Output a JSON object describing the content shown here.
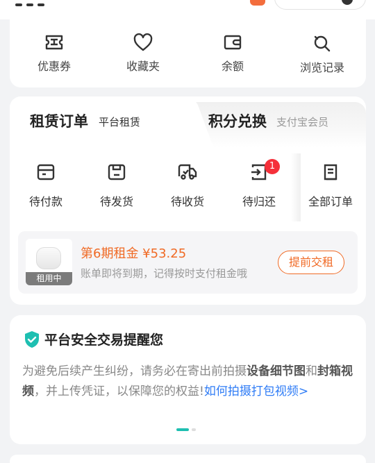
{
  "quick_links": [
    {
      "label": "优惠券",
      "icon": "coupon-icon"
    },
    {
      "label": "收藏夹",
      "icon": "heart-icon"
    },
    {
      "label": "余额",
      "icon": "wallet-icon"
    },
    {
      "label": "浏览记录",
      "icon": "history-icon"
    }
  ],
  "orders": {
    "tabs": [
      {
        "title": "租赁订单",
        "subtitle": "平台租赁",
        "active": true
      },
      {
        "title": "积分兑换",
        "subtitle": "支付宝会员",
        "active": false
      }
    ],
    "status_items": [
      {
        "label": "待付款",
        "icon": "pending-payment-icon",
        "badge": ""
      },
      {
        "label": "待发货",
        "icon": "pending-shipment-icon",
        "badge": ""
      },
      {
        "label": "待收货",
        "icon": "pending-receipt-icon",
        "badge": ""
      },
      {
        "label": "待归还",
        "icon": "pending-return-icon",
        "badge": "1"
      },
      {
        "label": "全部订单",
        "icon": "all-orders-icon",
        "badge": ""
      }
    ],
    "due": {
      "title": "第6期租金 ¥53.25",
      "subtitle": "账单即将到期，记得按时支付租金哦",
      "tag": "租用中",
      "button": "提前交租"
    }
  },
  "safety": {
    "title": "平台安全交易提醒您",
    "body_1": "为避免后续产生纠纷，请务必在寄出前拍摄",
    "bold_1": "设备细节图",
    "body_2": "和",
    "bold_2": "封箱视频",
    "body_3": "，并上传凭证，以保障您的权益!",
    "link": "如何拍摄打包视频>"
  },
  "colors": {
    "accent_orange": "#f06a25",
    "badge_red": "#f5303a",
    "link_blue": "#2f7cf6",
    "shield_teal": "#1ebfb1"
  }
}
